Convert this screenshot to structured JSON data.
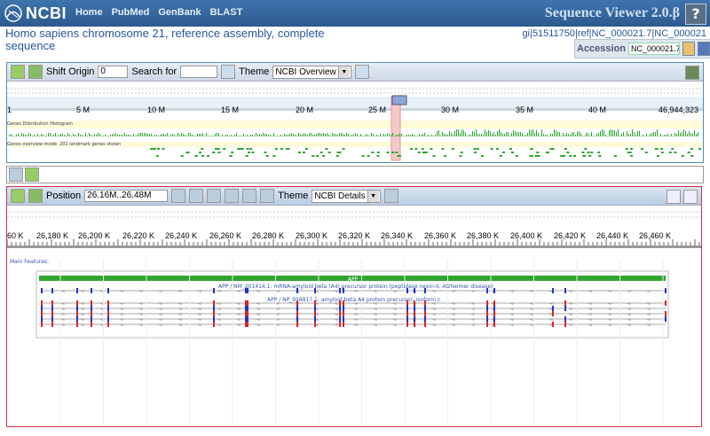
{
  "header": {
    "logo_text": "NCBI",
    "nav": [
      "Home",
      "PubMed",
      "GenBank",
      "BLAST"
    ],
    "app_title": "Sequence Viewer 2.0.β",
    "help_label": "?"
  },
  "sequence": {
    "title": "Homo sapiens chromosome 21, reference assembly, complete sequence",
    "ids": "gi|51511750|ref|NC_000021.7|NC_000021",
    "accession_label": "Accession",
    "accession_value": "NC_000021.7"
  },
  "overview_panel": {
    "shift_origin_label": "Shift Origin",
    "shift_origin_value": "0",
    "search_label": "Search for",
    "search_value": "",
    "theme_label": "Theme",
    "theme_value": "NCBI Overview",
    "ruler_ticks": [
      "1",
      "5 M",
      "10 M",
      "15 M",
      "20 M",
      "25 M",
      "30 M",
      "35 M",
      "40 M",
      "46,944,323"
    ],
    "histogram_label": "Genes Distribution Histogram",
    "genes_label": "Genes overview mode: 201 landmark genes shown"
  },
  "detail_panel": {
    "position_label": "Position",
    "position_value": "26.16M..26.48M",
    "theme_label": "Theme",
    "theme_value": "NCBI Details",
    "ruler_ticks": [
      "60 K",
      "26,180 K",
      "26,200 K",
      "26,220 K",
      "26,240 K",
      "26,260 K",
      "26,280 K",
      "26,300 K",
      "26,320 K",
      "26,340 K",
      "26,360 K",
      "26,380 K",
      "26,400 K",
      "26,420 K",
      "26,440 K",
      "26,460 K"
    ],
    "main_features_label": "Main Features:",
    "gene_label": "APP",
    "mrna_label": "APP / NM_201414.1: mRNA-amyloid beta (A4) precursor protein (peptidase nexin-II, Alzheimer disease)",
    "protein_label": "APP / NP_958817.1: amyloid beta A4 protein precursor, isoform c"
  },
  "colors": {
    "header_bg": "#2f5f95",
    "overview_border": "#4a8fb8",
    "detail_border": "#cc3344",
    "gene_green": "#2fa52f",
    "exon_blue": "#2233cc",
    "exon_red": "#dd2222"
  }
}
